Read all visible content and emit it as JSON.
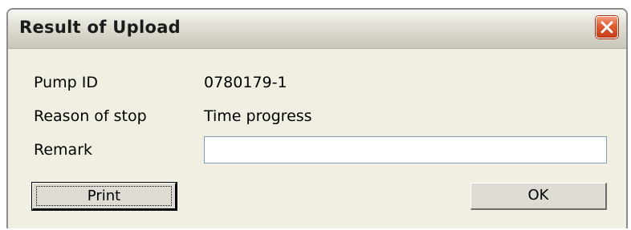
{
  "window": {
    "title": "Result of Upload",
    "close_icon": "close-icon"
  },
  "fields": {
    "pump_id_label": "Pump ID",
    "pump_id_value": "0780179-1",
    "reason_label": "Reason of stop",
    "reason_value": "Time progress",
    "remark_label": "Remark",
    "remark_value": ""
  },
  "buttons": {
    "print_label": "Print",
    "ok_label": "OK"
  },
  "colors": {
    "dialog_background": "#f1efe2",
    "close_button": "#e05a30",
    "input_border": "#7f9db9"
  }
}
